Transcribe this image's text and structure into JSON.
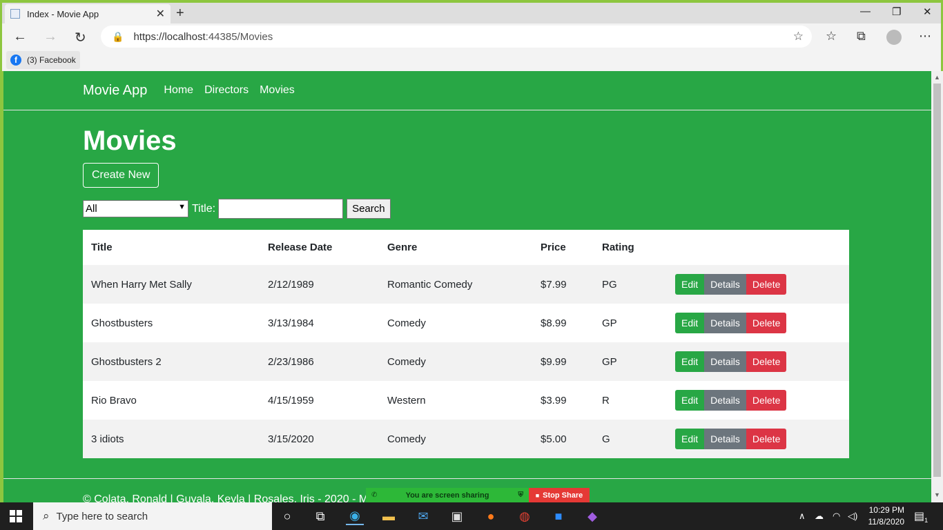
{
  "browser": {
    "tab_title": "Index - Movie App",
    "tab_close": "✕",
    "new_tab": "+",
    "minimize": "—",
    "maximize": "❐",
    "close": "✕",
    "url_host": "https://localhost",
    "url_rest": ":44385/Movies",
    "favorite_label": "(3) Facebook",
    "favorite_icon": "f"
  },
  "app": {
    "brand": "Movie App",
    "nav": [
      "Home",
      "Directors",
      "Movies"
    ],
    "page_title": "Movies",
    "create_new": "Create New",
    "filter": {
      "genre_selected": "All",
      "title_label": "Title:",
      "title_value": "",
      "search_button": "Search"
    },
    "table": {
      "headers": [
        "Title",
        "Release Date",
        "Genre",
        "Price",
        "Rating"
      ],
      "rows": [
        [
          "When Harry Met Sally",
          "2/12/1989",
          "Romantic Comedy",
          "$7.99",
          "PG"
        ],
        [
          "Ghostbusters",
          "3/13/1984",
          "Comedy",
          "$8.99",
          "GP"
        ],
        [
          "Ghostbusters 2",
          "2/23/1986",
          "Comedy",
          "$9.99",
          "GP"
        ],
        [
          "Rio Bravo",
          "4/15/1959",
          "Western",
          "$3.99",
          "R"
        ],
        [
          "3 idiots",
          "3/15/2020",
          "Comedy",
          "$5.00",
          "G"
        ]
      ],
      "actions": [
        "Edit",
        "Details",
        "Delete"
      ]
    },
    "footer": "© Colata, Ronald | Guyala, Keyla | Rosales, Iris - 2020 - Mov"
  },
  "share_banner": {
    "message": "You are screen sharing",
    "stop": "Stop Share"
  },
  "taskbar": {
    "search_placeholder": "Type here to search",
    "time": "10:29 PM",
    "date": "11/8/2020",
    "notification_count": "1"
  },
  "colors": {
    "page_green": "#28a745",
    "details_gray": "#6c757d",
    "delete_red": "#dc3545"
  }
}
